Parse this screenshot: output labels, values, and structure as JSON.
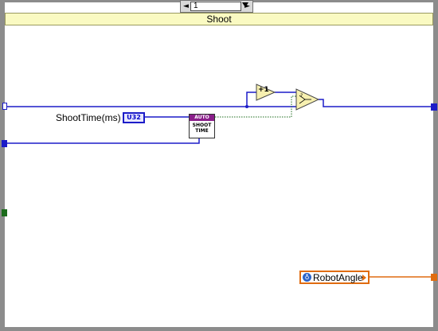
{
  "case_selector": {
    "value": "1",
    "left_arrow": "◄",
    "right_arrow": "►"
  },
  "case_label": "Shoot",
  "nodes": {
    "shoot_time_label": "ShootTime(ms)",
    "shoot_time_type": "U32",
    "subvi_banner": "AUTO",
    "subvi_line1": "SHOOT",
    "subvi_line2": "TIME",
    "increment_label": "+1",
    "global_variable": "RobotAngle",
    "globe_glyph": "♁"
  },
  "colors": {
    "numeric_wire": "#1c1cc8",
    "global_wire": "#e06c10",
    "boolean_wire": "#1c6b1c",
    "frame": "#8c8c8c",
    "label_bar": "#fafac2",
    "subvi_banner": "#8a1e8a"
  },
  "icons": {
    "increment": "increment-function-icon",
    "select": "select-function-icon",
    "globe": "global-variable-icon"
  }
}
